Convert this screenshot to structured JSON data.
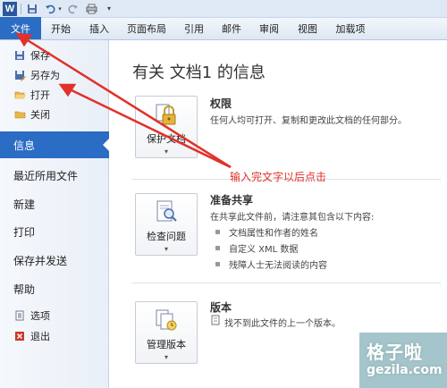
{
  "qat": {
    "logo": "W",
    "buttons": [
      {
        "name": "save-icon",
        "glyph": "▪"
      },
      {
        "name": "undo-icon",
        "glyph": "↶"
      },
      {
        "name": "redo-icon",
        "glyph": "↻"
      },
      {
        "name": "print-icon",
        "glyph": "⎙"
      }
    ],
    "more_glyph": "▾"
  },
  "ribbon": {
    "tabs": [
      "文件",
      "开始",
      "插入",
      "页面布局",
      "引用",
      "邮件",
      "审阅",
      "视图",
      "加载项"
    ]
  },
  "backstage": {
    "commands": [
      {
        "label": "保存",
        "icon": "save-icon"
      },
      {
        "label": "另存为",
        "icon": "save-as-icon"
      },
      {
        "label": "打开",
        "icon": "open-folder-icon"
      },
      {
        "label": "关闭",
        "icon": "close-folder-icon"
      }
    ],
    "panes": [
      "信息",
      "最近所用文件",
      "新建",
      "打印",
      "保存并发送",
      "帮助"
    ],
    "bottom": [
      {
        "label": "选项",
        "icon": "options-icon"
      },
      {
        "label": "退出",
        "icon": "exit-icon"
      }
    ]
  },
  "info": {
    "title": "有关 文档1 的信息",
    "sections": [
      {
        "button": "保护文档",
        "title": "权限",
        "desc": "任何人均可打开、复制和更改此文档的任何部分。"
      },
      {
        "button": "检查问题",
        "title": "准备共享",
        "desc": "在共享此文件前，请注意其包含以下内容:",
        "bullets": [
          "文档属性和作者的姓名",
          "自定义 XML 数据",
          "残障人士无法阅读的内容"
        ]
      },
      {
        "button": "管理版本",
        "title": "版本",
        "desc": "找不到此文件的上一个版本。"
      }
    ]
  },
  "annotation": "输入完文字以后点击",
  "watermark": {
    "cn": "格子啦",
    "en": "gezila.com"
  },
  "colors": {
    "accent": "#2b6cc4",
    "annotation": "#e2302a"
  }
}
